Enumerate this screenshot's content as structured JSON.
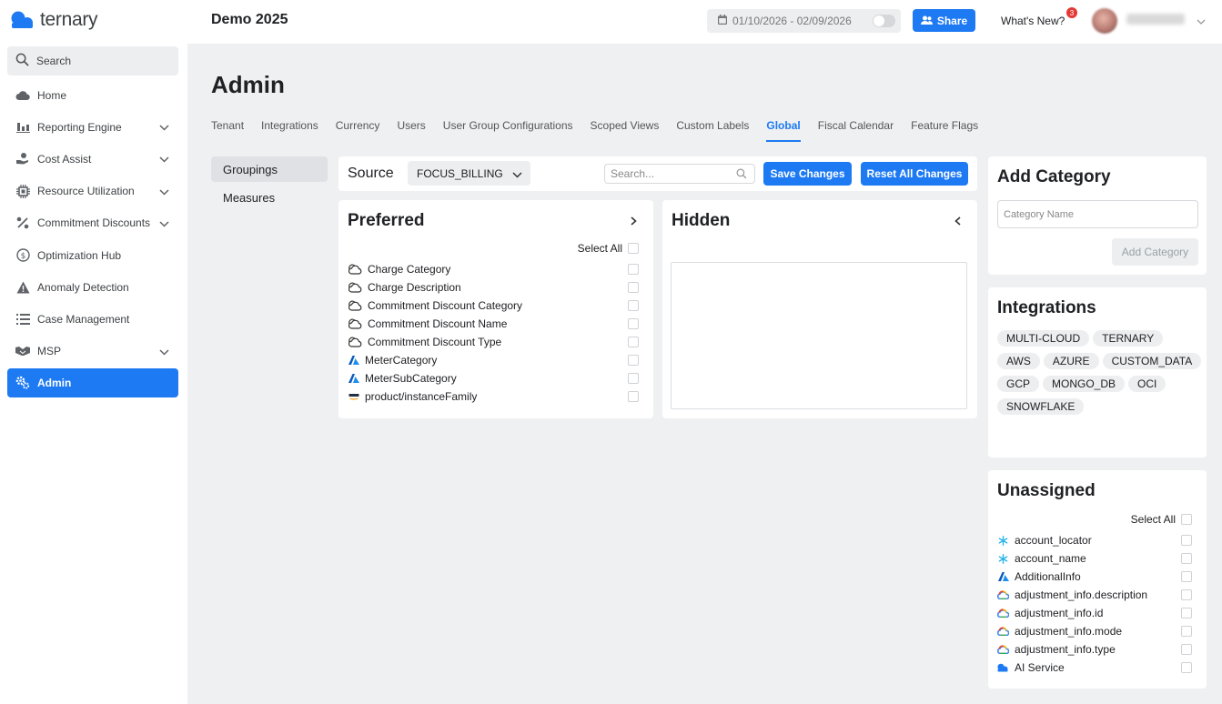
{
  "app": {
    "brand": "ternary",
    "accent": "#1d7af3"
  },
  "sidebar": {
    "search_label": "Search",
    "items": [
      {
        "label": "Home",
        "icon": "cloud-icon"
      },
      {
        "label": "Reporting Engine",
        "icon": "bar-chart-icon",
        "expandable": true
      },
      {
        "label": "Cost Assist",
        "icon": "hand-coin-icon",
        "expandable": true
      },
      {
        "label": "Resource Utilization",
        "icon": "chip-icon",
        "expandable": true
      },
      {
        "label": "Commitment Discounts",
        "icon": "percent-icon",
        "expandable": true
      },
      {
        "label": "Optimization Hub",
        "icon": "dollar-circle-icon"
      },
      {
        "label": "Anomaly Detection",
        "icon": "warning-icon"
      },
      {
        "label": "Case Management",
        "icon": "list-icon"
      },
      {
        "label": "MSP",
        "icon": "handshake-icon",
        "expandable": true
      },
      {
        "label": "Admin",
        "icon": "gears-icon",
        "active": true
      }
    ]
  },
  "header": {
    "title": "Demo 2025",
    "date_range": "01/10/2026 - 02/09/2026",
    "share_label": "Share",
    "whats_new_label": "What's New?",
    "notification_count": "3"
  },
  "page": {
    "title": "Admin",
    "tabs": [
      {
        "label": "Tenant"
      },
      {
        "label": "Integrations"
      },
      {
        "label": "Currency"
      },
      {
        "label": "Users"
      },
      {
        "label": "User Group Configurations"
      },
      {
        "label": "Scoped Views"
      },
      {
        "label": "Custom Labels"
      },
      {
        "label": "Global",
        "active": true
      },
      {
        "label": "Fiscal Calendar"
      },
      {
        "label": "Feature Flags"
      }
    ],
    "subnav": [
      "Groupings",
      "Measures"
    ]
  },
  "source_bar": {
    "label": "Source",
    "selected": "FOCUS_BILLING",
    "search_placeholder": "Search...",
    "save_label": "Save Changes",
    "reset_label": "Reset All Changes"
  },
  "preferred": {
    "title": "Preferred",
    "select_all_label": "Select All",
    "items": [
      {
        "label": "Charge Category",
        "icon": "multi-cloud-icon"
      },
      {
        "label": "Charge Description",
        "icon": "multi-cloud-icon"
      },
      {
        "label": "Commitment Discount Category",
        "icon": "multi-cloud-icon"
      },
      {
        "label": "Commitment Discount Name",
        "icon": "multi-cloud-icon"
      },
      {
        "label": "Commitment Discount Type",
        "icon": "multi-cloud-icon"
      },
      {
        "label": "MeterCategory",
        "icon": "azure-icon"
      },
      {
        "label": "MeterSubCategory",
        "icon": "azure-icon"
      },
      {
        "label": "product/instanceFamily",
        "icon": "aws-icon"
      }
    ]
  },
  "hidden": {
    "title": "Hidden"
  },
  "add_category": {
    "title": "Add Category",
    "input_placeholder": "Category Name",
    "button_label": "Add Category"
  },
  "integrations": {
    "title": "Integrations",
    "chips": [
      "MULTI-CLOUD",
      "TERNARY",
      "AWS",
      "AZURE",
      "CUSTOM_DATA",
      "GCP",
      "MONGO_DB",
      "OCI",
      "SNOWFLAKE"
    ]
  },
  "unassigned": {
    "title": "Unassigned",
    "select_all_label": "Select All",
    "items": [
      {
        "label": "account_locator",
        "icon": "snowflake-icon"
      },
      {
        "label": "account_name",
        "icon": "snowflake-icon"
      },
      {
        "label": "AdditionalInfo",
        "icon": "azure-icon"
      },
      {
        "label": "adjustment_info.description",
        "icon": "gcp-icon"
      },
      {
        "label": "adjustment_info.id",
        "icon": "gcp-icon"
      },
      {
        "label": "adjustment_info.mode",
        "icon": "gcp-icon"
      },
      {
        "label": "adjustment_info.type",
        "icon": "gcp-icon"
      },
      {
        "label": "AI Service",
        "icon": "ternary-icon"
      }
    ]
  }
}
